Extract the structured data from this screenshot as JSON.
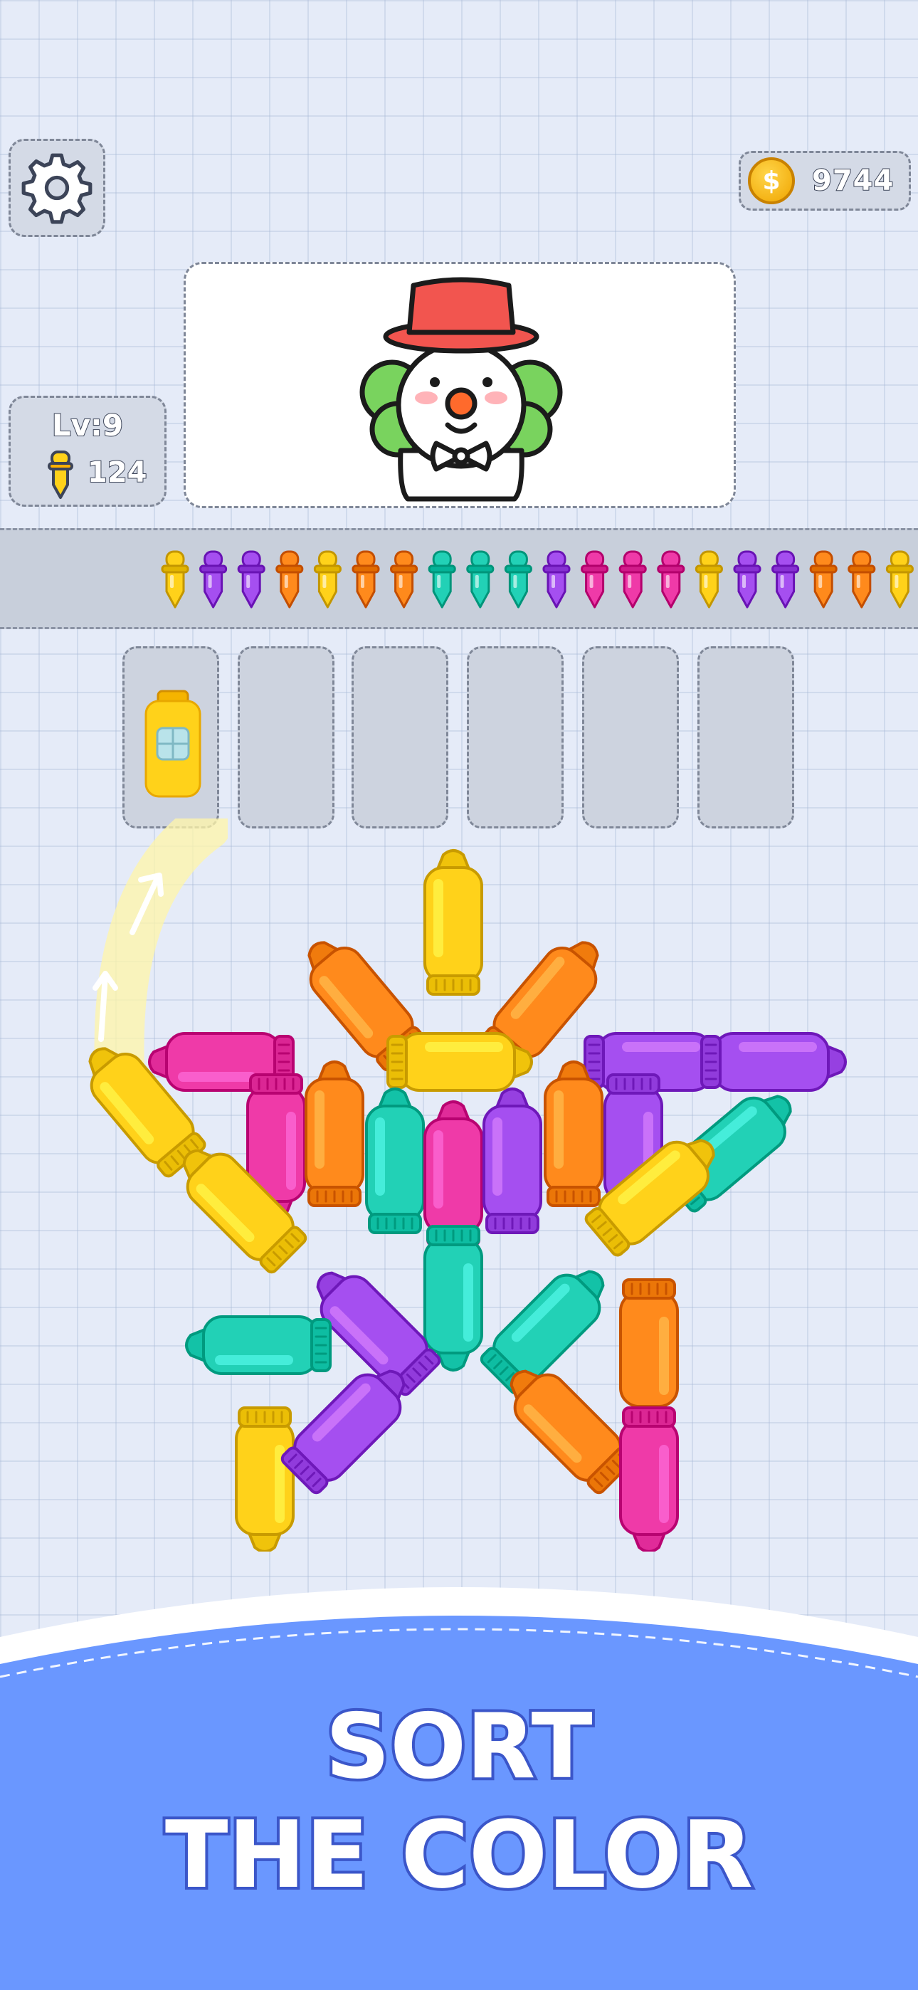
{
  "header": {
    "coins": "9744",
    "coin_symbol": "$",
    "level_label": "Lv:9",
    "drops_count": "124"
  },
  "queue_colors": [
    "yellow",
    "purple",
    "purple",
    "orange",
    "yellow",
    "orange",
    "orange",
    "teal",
    "teal",
    "teal",
    "purple",
    "magenta",
    "magenta",
    "magenta",
    "yellow",
    "purple",
    "purple",
    "orange",
    "orange",
    "yellow"
  ],
  "slots": [
    {
      "filled": true,
      "color": "yellow"
    },
    {
      "filled": false
    },
    {
      "filled": false
    },
    {
      "filled": false
    },
    {
      "filled": false
    },
    {
      "filled": false
    }
  ],
  "board_pieces": [
    {
      "color": "yellow",
      "angle": 0
    },
    {
      "color": "orange",
      "angle": -40
    },
    {
      "color": "orange",
      "angle": 40
    },
    {
      "color": "magenta",
      "angle": -90
    },
    {
      "color": "yellow",
      "angle": 90
    },
    {
      "color": "purple",
      "angle": 90
    },
    {
      "color": "purple",
      "angle": 90
    },
    {
      "color": "yellow",
      "angle": -40
    },
    {
      "color": "magenta",
      "angle": 180
    },
    {
      "color": "orange",
      "angle": 0
    },
    {
      "color": "teal",
      "angle": 0
    },
    {
      "color": "magenta",
      "angle": 0
    },
    {
      "color": "purple",
      "angle": 0
    },
    {
      "color": "orange",
      "angle": 0
    },
    {
      "color": "purple",
      "angle": 180
    },
    {
      "color": "teal",
      "angle": 50
    },
    {
      "color": "yellow",
      "angle": -45
    },
    {
      "color": "yellow",
      "angle": 50
    },
    {
      "color": "teal",
      "angle": 180
    },
    {
      "color": "purple",
      "angle": -45
    },
    {
      "color": "teal",
      "angle": -90
    },
    {
      "color": "teal",
      "angle": 45
    },
    {
      "color": "orange",
      "angle": 180
    },
    {
      "color": "yellow",
      "angle": 180
    },
    {
      "color": "purple",
      "angle": 45
    },
    {
      "color": "orange",
      "angle": -45
    },
    {
      "color": "magenta",
      "angle": 180
    }
  ],
  "colors": {
    "yellow": "#ffd21a",
    "orange": "#ff8a1c",
    "purple": "#a54ff0",
    "teal": "#22d1b6",
    "magenta": "#ef3aa8",
    "banner": "#6a97ff"
  },
  "banner": {
    "line1": "SORT",
    "line2": "THE COLOR"
  },
  "icons": [
    "gear-icon",
    "coin-icon",
    "dropper-icon",
    "clown-picture",
    "hint-arrow-icon"
  ]
}
